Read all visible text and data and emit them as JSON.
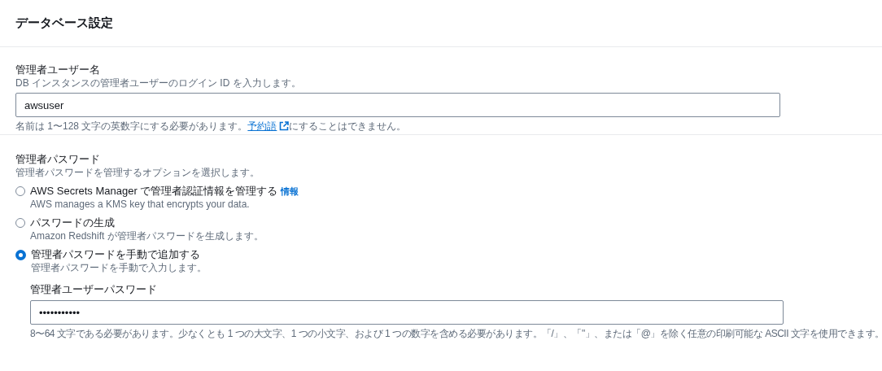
{
  "header": {
    "title": "データベース設定"
  },
  "username": {
    "label": "管理者ユーザー名",
    "description": "DB インスタンスの管理者ユーザーのログイン ID を入力します。",
    "value": "awsuser",
    "constraint_before": "名前は 1〜128 文字の英数字にする必要があります。",
    "link": "予約語",
    "constraint_after": "にすることはできません。"
  },
  "password": {
    "label": "管理者パスワード",
    "description": "管理者パスワードを管理するオプションを選択します。",
    "options": [
      {
        "label": "AWS Secrets Manager で管理者認証情報を管理する",
        "info": "情報",
        "description": "AWS manages a KMS key that encrypts your data.",
        "selected": false
      },
      {
        "label": "パスワードの生成",
        "description": "Amazon Redshift が管理者パスワードを生成します。",
        "selected": false
      },
      {
        "label": "管理者パスワードを手動で追加する",
        "description": "管理者パスワードを手動で入力します。",
        "selected": true
      }
    ],
    "manual": {
      "label": "管理者ユーザーパスワード",
      "value": "•••••••••••",
      "constraint": "8〜64 文字である必要があります。少なくとも 1 つの大文字、1 つの小文字、および 1 つの数字を含める必要があります。「/」、「\"」、または「@」を除く任意の印刷可能な ASCII 文字を使用できます。"
    }
  }
}
